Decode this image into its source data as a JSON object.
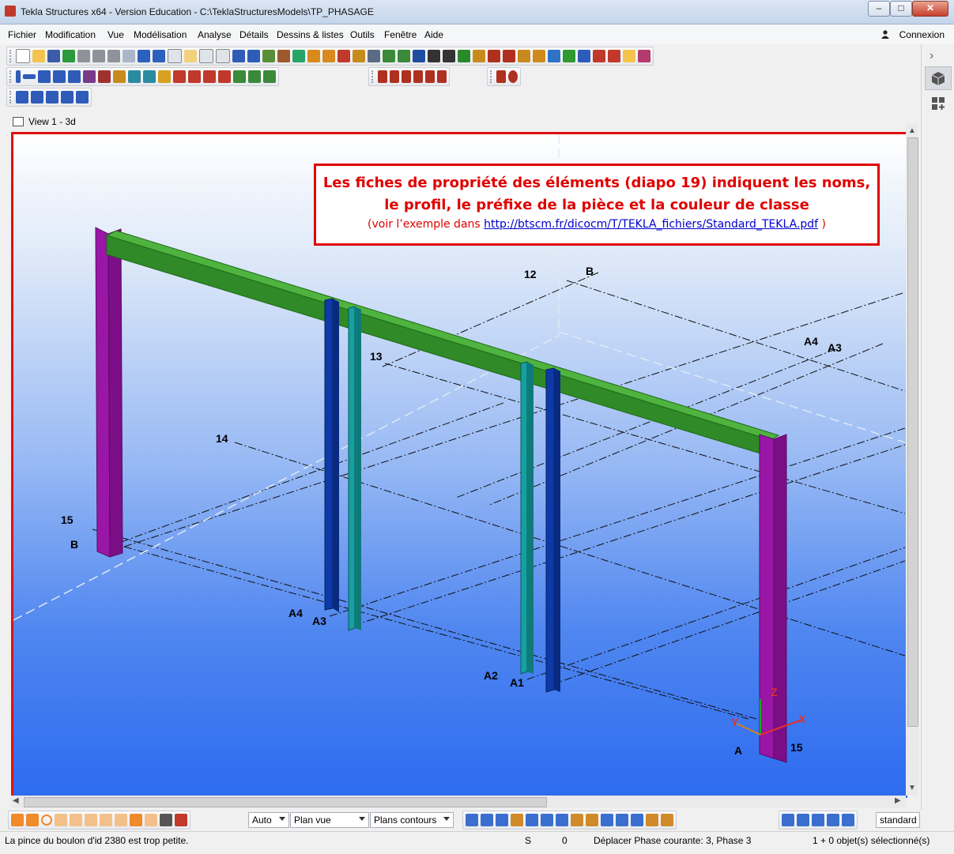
{
  "window": {
    "title": "Tekla Structures x64 - Version Education - C:\\TeklaStructuresModels\\TP_PHASAGE",
    "minimize": "–",
    "maximize": "□",
    "close": "✕"
  },
  "menu": {
    "items": [
      "Fichier",
      "Modification",
      "Vue",
      "Modélisation",
      "Analyse",
      "Détails",
      "Dessins & listes",
      "Outils",
      "Fenêtre",
      "Aide"
    ],
    "connexion": "Connexion"
  },
  "view": {
    "title": "View 1 - 3d"
  },
  "annotation": {
    "line1": "Les fiches de propriété des éléments (diapo 19) indiquent les noms, le profil, le préfixe de la pièce et la couleur de classe",
    "line2_prefix": "(voir l’exemple dans ",
    "link": "http://btscm.fr/dicocm/T/TEKLA_fichiers/Standard_TEKLA.pdf",
    "line2_suffix": " )"
  },
  "grid_labels": [
    "12",
    "B",
    "13",
    "A4",
    "A3",
    "14",
    "15",
    "B",
    "A4",
    "A3",
    "A2",
    "A1",
    "A",
    "15"
  ],
  "axes": {
    "x": "X",
    "y": "Y",
    "z": "Z"
  },
  "colors": {
    "beam": "#3a9a2e",
    "column_purple": "#9b18a8",
    "column_blue": "#0d3aa0",
    "column_teal": "#16908f",
    "view_border": "#e01010"
  },
  "bottom_toolbar": {
    "combo1": "Auto",
    "combo2": "Plan vue",
    "combo3": "Plans contours",
    "standard": "standard"
  },
  "status": {
    "message": "La pince du boulon d'id 2380 est trop petite.",
    "s": "S",
    "zero": "0",
    "phase": "Déplacer Phase courante: 3, Phase 3",
    "selected": "1 + 0 objet(s) sélectionné(s)"
  }
}
